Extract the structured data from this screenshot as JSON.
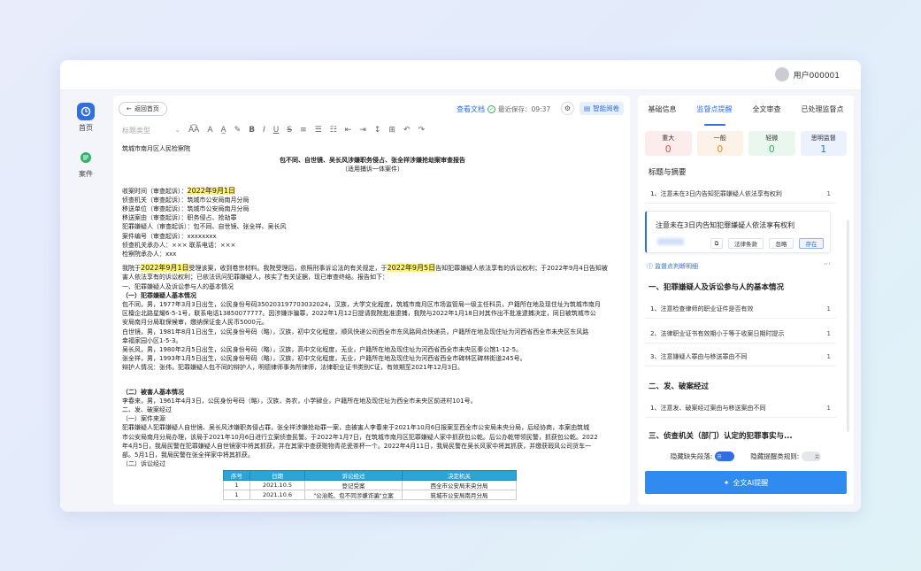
{
  "topbar": {
    "user_name": "用户000001"
  },
  "nav": {
    "items": [
      {
        "label": "首页"
      },
      {
        "label": "案件"
      }
    ]
  },
  "doc": {
    "back_label": "返回首页",
    "view_doc_label": "查看文档",
    "saved_label": "最近保存：09:37",
    "smart_review_label": "智能阅卷",
    "toolbar": {
      "heading_select": "标题类型"
    },
    "lines": [
      "筑城市南月区人民检察院",
      "包不同、自世镜、吴长风涉嫌职务侵占、张全祥涉嫌抢劫案审查报告",
      "（适用捕诉一体案件）",
      "收案时间（审查起诉）：",
      "2022年9月1日",
      "侦查机关（审查起诉）：筑城市公安局南月分局",
      "移送单位（审查起诉）：筑城市公安局南月分局",
      "移送案由（审查起诉）：职务侵占、抢劫罪",
      "犯罪嫌疑人（审查起诉）：包不同、自世镜、张全祥、吴长风",
      "案件编号（审查起诉）：xxxxxxxx",
      "侦查机关承办人：××× 联系电话：×××",
      "检察院承办人：xxx",
      "我院于",
      "2022年9月1日",
      "受理该案，收到卷宗材料。我院受理后，依照刑事诉讼法的有关规定，于",
      "2022年9月5日",
      "告知犯罪嫌疑人依法享有的诉讼权利；于2022年9月4日告知被",
      "害人依法享有的诉讼权利；已依法讯问犯罪嫌疑人，核实了有关证据，现已审查终结。报告如下：",
      "一、犯罪嫌疑人及诉讼参与人的基本情况",
      "（一）犯罪嫌疑人基本情况",
      "包不同，男，1977年3月3日出生，公民身份号码350203197703032024，汉族，大学文化程度，筑城市南月区市场监管局一级主任科员，户籍所在地及现住址为筑城市南月",
      "区檀企北路星耀6-5-1号，联系电话13850077777。因涉嫌诈骗罪，2022年1月12日提请我院批准逮捕，我院与2022年1月18日对其作出不批准逮捕决定，同日被筑城市公",
      "安局南月分局取保候审，缴纳保证金人民币5000元。",
      "白世镜，男，1981年8月1日出生，公民身份号码（略），汉族，初中文化程度，顺风快递公司西全市东风路网点快递员，户籍所在地及现住址为河西省西全市未央区东风路",
      "幸福家园小区1-5-3。",
      "吴长风，男，1980年2月5日出生，公民身份号码（略），汉族，高中文化程度，无业，户籍所在地及现住址为河西省西全市未央区秦公馆1-12-5。",
      "张全祥，男，1993年1月5日出生，公民身份号码（略），汉族，初中文化程度，无业，户籍所在地及现住址为河西省西全市碑林区碑林街道245号。",
      "辩护人情况：张伟，犯罪嫌疑人包不同的辩护人，明德律师事务所律师，法律职业证书类别C证，有效期至2021年12月3日。",
      "（二）被害人基本情况",
      "李春来，男，1961年4月3日，公民身份号码（略），汉族，务农，小学肄业，户籍所在地及现住址为西全市未央区前进村101号。",
      "二、发、破案经过",
      "（一）案件来源",
      "犯罪嫌疑人犯罪嫌疑人自世镜、吴长风涉嫌职务侵占罪，张全祥涉嫌抢劫罪一案，由被害人李春来于2021年10月6日报案至西全市公安局未央分局，后经协商，本案由筑城",
      "市公安局南月分局办理，该局于2021年10月6日进行立案侦查民警。于2022年1月7日，在筑城市南月区犯罪嫌疑人家中抓获包公乾。后公办乾带领民警，抓获包公乾。2022",
      "年4月5日，我局民警在犯罪嫌疑人自世镜家中将其抓获，并在其家中查获赃物青花瓷茶杯一个。2022年4月11日，我局民警在吴长风家中将其抓获，并缴获瑕风公司货车一",
      "部。5月1日，我局民警在张全祥家中将其抓获。",
      "（二）诉讼经过"
    ],
    "table": {
      "headers": [
        "序号",
        "日期",
        "诉讼经过",
        "决定机关"
      ],
      "rows": [
        [
          "1",
          "2021.10.5",
          "登记受案",
          "西全市公安局未央分局"
        ],
        [
          "1",
          "2021.10.6",
          "\"公治乾、包不同涉嫌诈骗\"立案",
          "筑城市公安局南月分局"
        ]
      ]
    }
  },
  "right": {
    "tabs": [
      "基础信息",
      "监督点提醒",
      "全文审查",
      "已处理监督点"
    ],
    "cards": [
      {
        "label": "重大",
        "value": "0",
        "color": "#e54b4b",
        "bg": "#fdecec"
      },
      {
        "label": "一般",
        "value": "0",
        "color": "#f08a24",
        "bg": "#fdf2e7"
      },
      {
        "label": "轻微",
        "value": "0",
        "color": "#2fb36b",
        "bg": "#e9f7ef"
      },
      {
        "label": "思明监督",
        "value": "1",
        "color": "#2f6fe0",
        "bg": "#ebf1fd"
      }
    ],
    "sections": [
      "标题与摘要",
      "一、犯罪嫌疑人及诉讼参与人的基本情况",
      "二、发、破案经过",
      "三、侦查机关（部门）认定的犯罪事实与..."
    ],
    "rows": [
      {
        "text": "1、注意未在3日内告知犯罪嫌疑人依法享有权利",
        "count": "1"
      },
      {
        "text": "1、注意检查律师的职业证件是否有效",
        "count": "1"
      },
      {
        "text": "2、法律职业证书有效期小于等于收案日期时提示",
        "count": "1"
      },
      {
        "text": "3、注意嫌疑人罪由与移送罪由不同",
        "count": "1"
      },
      {
        "text": "1、注意发、破案经过案由与移送案由不同",
        "count": "1"
      }
    ],
    "detail": {
      "title": "注意未在3日内告知犯罪嫌疑人依法享有权利",
      "btn_rule": "法律条款",
      "btn_ignore": "忽略",
      "btn_keep": "存在"
    },
    "supervise_link": "监督点判断明细",
    "toggles": {
      "hide_missing": "隐藏缺失段落:",
      "hide_missing_state": "开",
      "hide_rule": "隐藏提醒类规则:",
      "hide_rule_state": "关"
    },
    "ai_button": "全文AI提醒"
  }
}
